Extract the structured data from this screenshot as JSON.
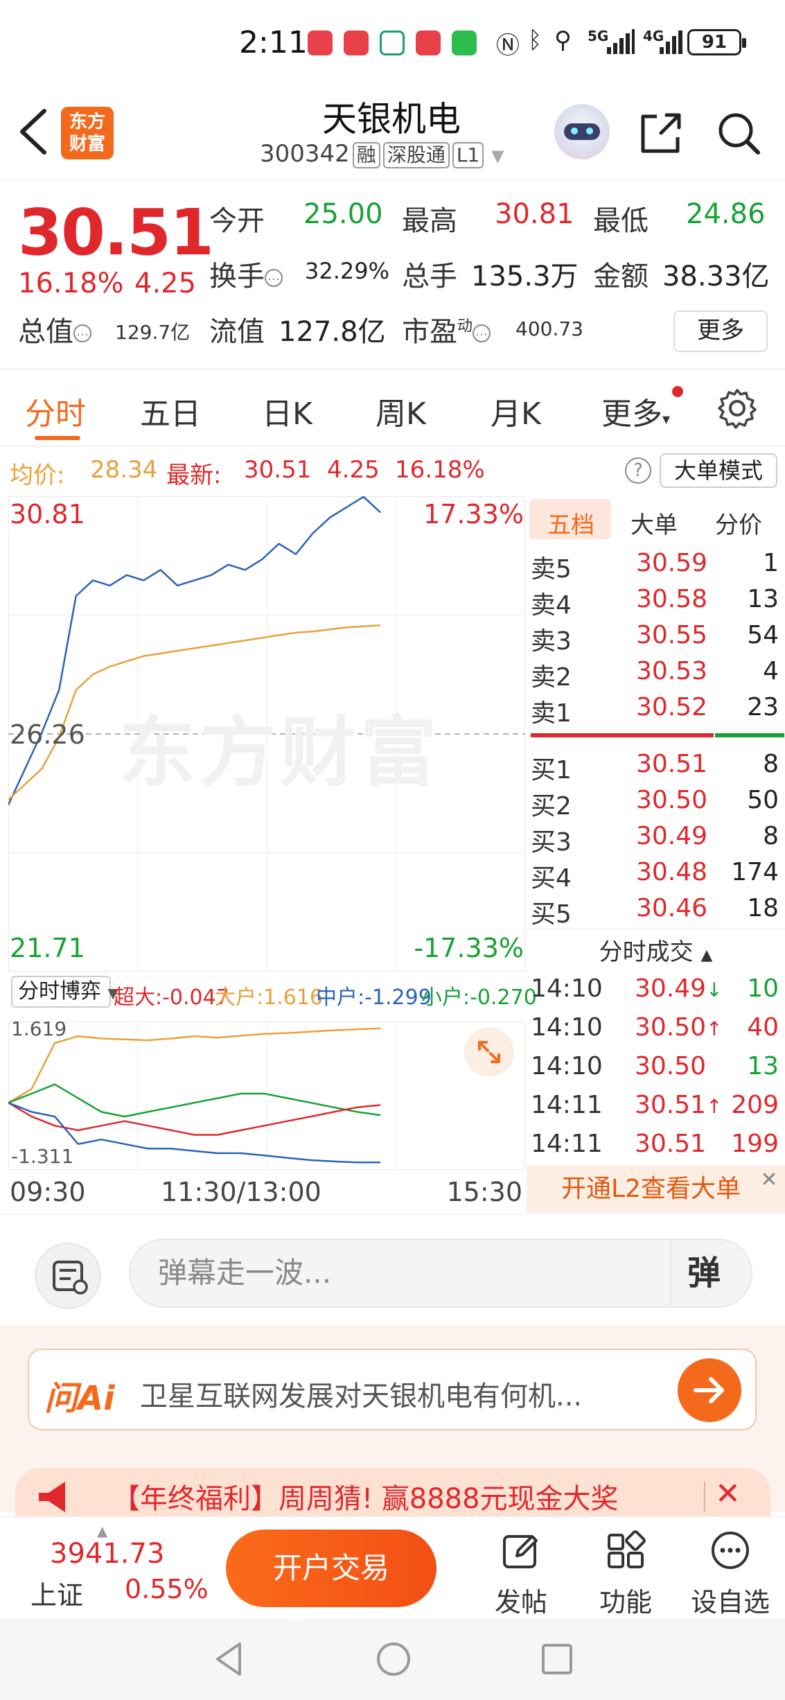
{
  "status_bar": {
    "time": "2:11",
    "network1": "5G",
    "network2": "4G",
    "battery": "91",
    "app_icons": [
      "huawei-store-icon",
      "huawei-store-icon",
      "vmall-icon",
      "red-app-icon",
      "wechat-icon"
    ]
  },
  "header": {
    "brand_line1": "东方",
    "brand_line2": "财富",
    "stock_name": "天银机电",
    "stock_code": "300342",
    "tags": [
      "融",
      "深股通",
      "L1"
    ]
  },
  "quote": {
    "last_price": "30.51",
    "change_pct": "16.18%",
    "change_amt": "4.25",
    "open_label": "今开",
    "open_val": "25.00",
    "high_label": "最高",
    "high_val": "30.81",
    "low_label": "最低",
    "low_val": "24.86",
    "turnover_label": "换手",
    "turnover_val": "32.29%",
    "volume_label": "总手",
    "volume_val": "135.3万",
    "amount_label": "金额",
    "amount_val": "38.33亿",
    "mktcap_label": "总值",
    "mktcap_val": "129.7亿",
    "float_label": "流值",
    "float_val": "127.8亿",
    "pe_label": "市盈",
    "pe_sup": "动",
    "pe_val": "400.73",
    "more_label": "更多"
  },
  "tabs": {
    "items": [
      "分时",
      "五日",
      "日K",
      "周K",
      "月K",
      "更多"
    ],
    "active": "分时"
  },
  "avg_row": {
    "avg_label": "均价:",
    "avg_val": "28.34",
    "latest_label": "最新:",
    "latest_val": "30.51",
    "latest_chg": "4.25",
    "latest_pct": "16.18%",
    "big_order_mode": "大单模式"
  },
  "chart": {
    "y_top": "30.81",
    "y_top_pct": "17.33%",
    "y_mid": "26.26",
    "y_bottom": "21.71",
    "y_bottom_pct": "-17.33%",
    "watermark": "东方财富",
    "boyi_select": "分时博弈",
    "boyi_super_label": "超大:",
    "boyi_super_val": "-0.047",
    "boyi_big_label": "大户:",
    "boyi_big_val": "1.616",
    "boyi_mid_label": "中户:",
    "boyi_mid_val": "-1.299",
    "boyi_small_label": "小户:",
    "boyi_small_val": "-0.270",
    "sub_top": "1.619",
    "sub_bottom": "-1.311",
    "time_start": "09:30",
    "time_mid": "11:30/13:00",
    "time_end": "15:30"
  },
  "chart_data": {
    "type": "line",
    "series": [
      {
        "name": "最新",
        "color": "#2a62b8",
        "values": [
          24.9,
          25.6,
          26.3,
          27.1,
          28.9,
          29.2,
          29.1,
          29.3,
          29.2,
          29.4,
          29.1,
          29.2,
          29.3,
          29.5,
          29.4,
          29.6,
          29.9,
          29.7,
          30.1,
          30.4,
          30.6,
          30.8,
          30.5
        ]
      },
      {
        "name": "均价",
        "color": "#e8a13a",
        "values": [
          25.0,
          25.3,
          25.6,
          26.2,
          27.1,
          27.4,
          27.55,
          27.65,
          27.75,
          27.8,
          27.85,
          27.9,
          27.95,
          28.0,
          28.05,
          28.1,
          28.15,
          28.2,
          28.22,
          28.26,
          28.3,
          28.32,
          28.34
        ]
      }
    ],
    "ylim": [
      21.71,
      30.81
    ],
    "ref_line": 26.26
  },
  "boyi_data": {
    "series": [
      {
        "color": "#e8a13a",
        "values": [
          0,
          0.3,
          1.3,
          1.45,
          1.4,
          1.38,
          1.36,
          1.4,
          1.45,
          1.42,
          1.46,
          1.5,
          1.52,
          1.55,
          1.58,
          1.6,
          1.62
        ]
      },
      {
        "color": "#17a235",
        "values": [
          0,
          0.2,
          0.4,
          0.1,
          -0.2,
          -0.3,
          -0.2,
          -0.1,
          0.0,
          0.1,
          0.2,
          0.2,
          0.1,
          0.0,
          -0.1,
          -0.2,
          -0.27
        ]
      },
      {
        "color": "#e0282c",
        "values": [
          0,
          -0.3,
          -0.5,
          -0.6,
          -0.5,
          -0.4,
          -0.5,
          -0.6,
          -0.7,
          -0.7,
          -0.6,
          -0.5,
          -0.4,
          -0.3,
          -0.2,
          -0.1,
          -0.05
        ]
      },
      {
        "color": "#2a62b8",
        "values": [
          0,
          -0.2,
          -0.3,
          -0.9,
          -0.8,
          -0.9,
          -1.0,
          -1.0,
          -1.05,
          -1.1,
          -1.1,
          -1.15,
          -1.2,
          -1.25,
          -1.28,
          -1.3,
          -1.3
        ]
      }
    ],
    "ylim": [
      -1.311,
      1.619
    ]
  },
  "order_book": {
    "tabs": [
      "五档",
      "大单",
      "分价"
    ],
    "asks": [
      {
        "label": "卖5",
        "price": "30.59",
        "vol": "1"
      },
      {
        "label": "卖4",
        "price": "30.58",
        "vol": "13"
      },
      {
        "label": "卖3",
        "price": "30.55",
        "vol": "54"
      },
      {
        "label": "卖2",
        "price": "30.53",
        "vol": "4"
      },
      {
        "label": "卖1",
        "price": "30.52",
        "vol": "23"
      }
    ],
    "bids": [
      {
        "label": "买1",
        "price": "30.51",
        "vol": "8"
      },
      {
        "label": "买2",
        "price": "30.50",
        "vol": "50"
      },
      {
        "label": "买3",
        "price": "30.49",
        "vol": "8"
      },
      {
        "label": "买4",
        "price": "30.48",
        "vol": "174"
      },
      {
        "label": "买5",
        "price": "30.46",
        "vol": "18"
      }
    ],
    "ticks_title": "分时成交",
    "ticks": [
      {
        "time": "14:10",
        "price": "30.49",
        "arrow": "↓",
        "vol": "10",
        "color": "#17a235"
      },
      {
        "time": "14:10",
        "price": "30.50",
        "arrow": "↑",
        "vol": "40",
        "color": "#e0282c"
      },
      {
        "time": "14:10",
        "price": "30.50",
        "arrow": "",
        "vol": "13",
        "color": "#17a235"
      },
      {
        "time": "14:11",
        "price": "30.51",
        "arrow": "↑",
        "vol": "209",
        "color": "#e0282c"
      },
      {
        "time": "14:11",
        "price": "30.51",
        "arrow": "",
        "vol": "199",
        "color": "#e0282c"
      }
    ],
    "l2_banner": "开通L2查看大单"
  },
  "comment": {
    "placeholder": "弹幕走一波...",
    "toggle_label": "弹"
  },
  "ai": {
    "logo": "问Ai",
    "question": "卫星互联网发展对天银机电有何机..."
  },
  "promo": {
    "text": "【年终福利】周周猜!  赢8888元现金大奖"
  },
  "bottom": {
    "index_val": "3941.73",
    "index_name": "上证",
    "index_pct": "0.55%",
    "trade_btn": "开户交易",
    "nav": [
      "发帖",
      "功能",
      "设自选"
    ]
  }
}
